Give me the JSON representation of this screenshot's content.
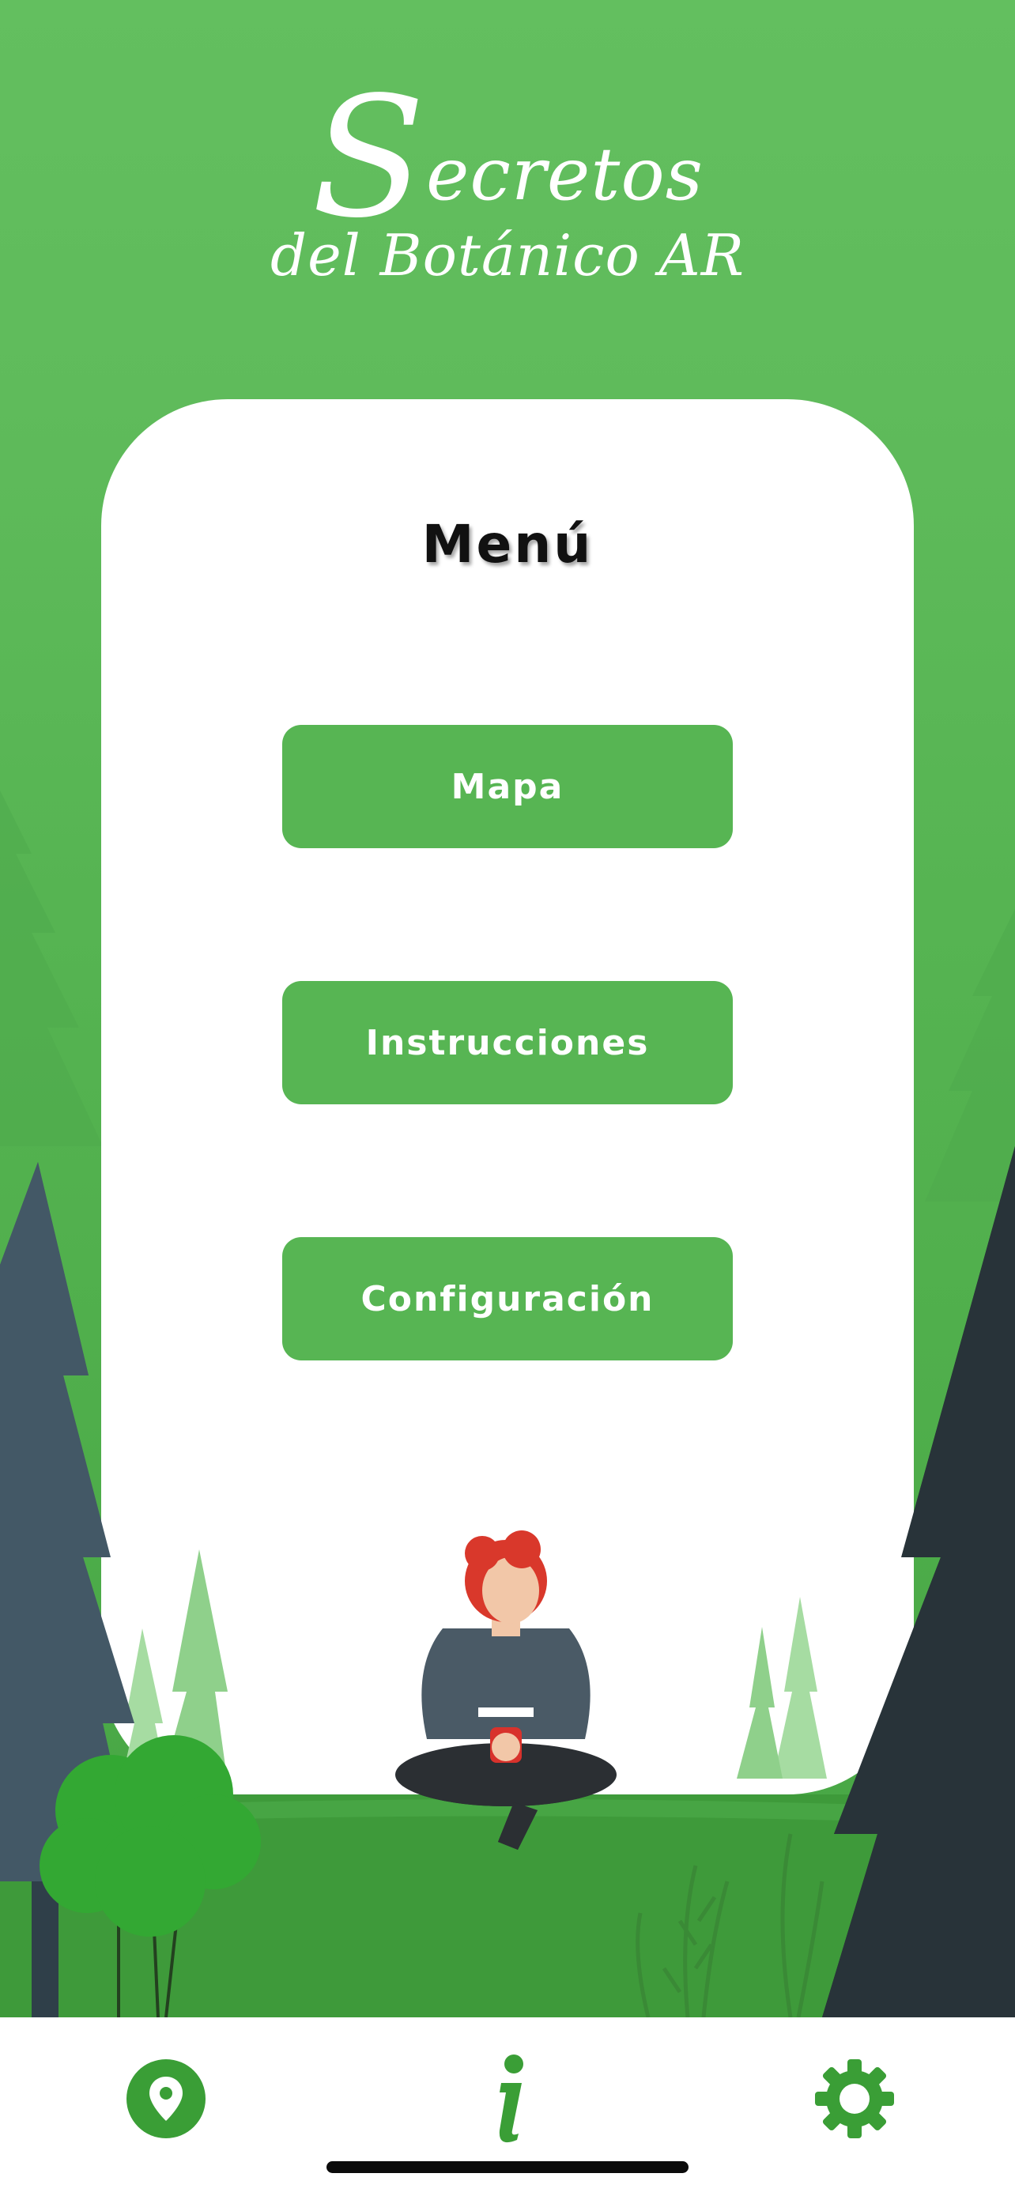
{
  "app": {
    "logo_line1_initial": "S",
    "logo_line1_rest": "ecretos",
    "logo_line2": "del Botánico AR"
  },
  "menu": {
    "title": "Menú",
    "buttons": [
      {
        "label": "Mapa"
      },
      {
        "label": "Instrucciones"
      },
      {
        "label": "Configuración"
      }
    ]
  },
  "tabbar": {
    "items": [
      {
        "icon": "map-pin-icon"
      },
      {
        "icon": "info-icon"
      },
      {
        "icon": "gear-icon"
      }
    ]
  },
  "colors": {
    "brand_green": "#57b553",
    "icon_green": "#3a9e36",
    "dark_tree": "#283339",
    "slate_tree": "#435866",
    "ground": "#3e9a3a"
  }
}
